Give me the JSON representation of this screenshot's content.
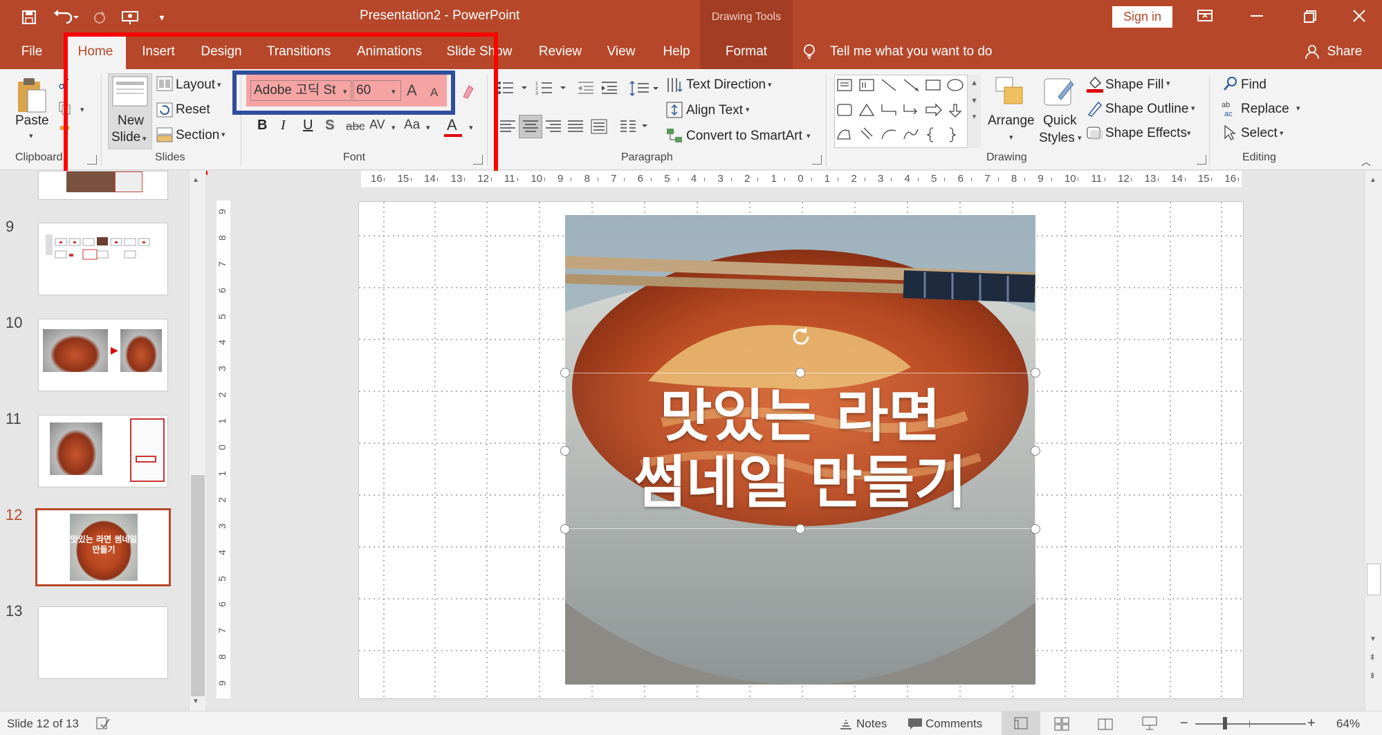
{
  "window": {
    "title": "Presentation2  -  PowerPoint",
    "context_tool": "Drawing Tools",
    "sign_in": "Sign in"
  },
  "tabs": {
    "file": "File",
    "home": "Home",
    "insert": "Insert",
    "design": "Design",
    "transitions": "Transitions",
    "animations": "Animations",
    "slideshow": "Slide Show",
    "review": "Review",
    "view": "View",
    "help": "Help",
    "format": "Format",
    "tell_me": "Tell me what you want to do",
    "share": "Share"
  },
  "ribbon": {
    "clipboard": {
      "paste": "Paste",
      "label": "Clipboard"
    },
    "slides": {
      "new_slide_1": "New",
      "new_slide_2": "Slide",
      "layout": "Layout",
      "reset": "Reset",
      "section": "Section",
      "label": "Slides"
    },
    "font": {
      "font_name": "Adobe 고딕 St",
      "font_size": "60",
      "label": "Font",
      "bold": "B",
      "italic": "I",
      "underline": "U",
      "shadow": "S",
      "strike": "abc",
      "spacing": "AV",
      "case": "Aa",
      "grow": "A",
      "shrink": "A",
      "color": "A"
    },
    "paragraph": {
      "text_direction": "Text Direction",
      "align_text": "Align Text",
      "convert": "Convert to SmartArt",
      "label": "Paragraph"
    },
    "drawing": {
      "arrange": "Arrange",
      "quick_styles_1": "Quick",
      "quick_styles_2": "Styles",
      "shape_fill": "Shape Fill",
      "shape_outline": "Shape Outline",
      "shape_effects": "Shape Effects",
      "label": "Drawing"
    },
    "editing": {
      "find": "Find",
      "replace": "Replace",
      "select": "Select",
      "label": "Editing"
    }
  },
  "slides_panel": {
    "thumbnails": [
      {
        "num": "9"
      },
      {
        "num": "10"
      },
      {
        "num": "11"
      },
      {
        "num": "12",
        "text": "맛있는 라면 썸네일 만들기",
        "selected": true
      },
      {
        "num": "13"
      }
    ]
  },
  "slide": {
    "line1": "맛있는 라면",
    "line2": "썸네일 만들기"
  },
  "ruler": {
    "h_ticks": [
      "16",
      "15",
      "14",
      "13",
      "12",
      "11",
      "10",
      "9",
      "8",
      "7",
      "6",
      "5",
      "4",
      "3",
      "2",
      "1",
      "0",
      "1",
      "2",
      "3",
      "4",
      "5",
      "6",
      "7",
      "8",
      "9",
      "10",
      "11",
      "12",
      "13",
      "14",
      "15",
      "16"
    ],
    "v_ticks": [
      "9",
      "8",
      "7",
      "6",
      "5",
      "4",
      "3",
      "2",
      "1",
      "0",
      "1",
      "2",
      "3",
      "4",
      "5",
      "6",
      "7",
      "8",
      "9"
    ]
  },
  "status": {
    "slide_of": "Slide 12 of 13",
    "notes": "Notes",
    "comments": "Comments",
    "zoom": "64%",
    "minus": "−",
    "plus": "+"
  },
  "colors": {
    "accent": "#b7472a",
    "highlight_red": "#ff0000",
    "highlight_blue": "#2f4e9c",
    "font_box_bg": "#f4a3a3"
  }
}
